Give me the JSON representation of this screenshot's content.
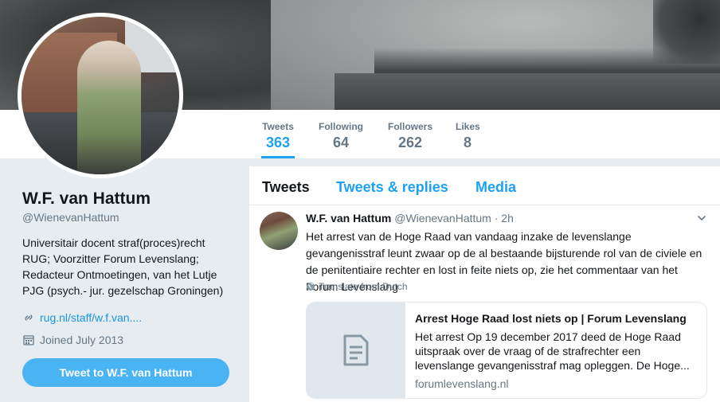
{
  "profile": {
    "name": "W.F. van Hattum",
    "handle": "@WienevanHattum",
    "bio": "Universitair docent straf(proces)recht RUG; Voorzitter Forum Levenslang; Redacteur Ontmoetingen, van het Lutje PJG (psych.- jur. gezelschap Groningen)",
    "website": "rug.nl/staff/w.f.van....",
    "joined": "Joined July 2013",
    "tweet_button": "Tweet to W.F. van Hattum"
  },
  "stats": [
    {
      "label": "Tweets",
      "value": "363"
    },
    {
      "label": "Following",
      "value": "64"
    },
    {
      "label": "Followers",
      "value": "262"
    },
    {
      "label": "Likes",
      "value": "8"
    }
  ],
  "tabs": [
    "Tweets",
    "Tweets & replies",
    "Media"
  ],
  "tweet": {
    "name": "W.F. van Hattum",
    "handle": "@WienevanHattum",
    "time": "· 2h",
    "text": "Het arrest van de Hoge Raad van vandaag inzake de levenslange gevangenisstraf leunt zwaar op de al bestaande bijsturende rol van de civiele en de penitentiaire rechter en lost in feite niets op, zie het commentaar van het Forum Levenslang",
    "translate": "Translate from Dutch",
    "card": {
      "title": "Arrest Hoge Raad lost niets op | Forum Levenslang",
      "description": "Het arrest Op 19 december 2017 deed de Hoge Raad uitspraak over de vraag of de strafrechter een levenslange gevangenisstraf mag opleggen. De Hoge...",
      "domain": "forumlevenslang.nl"
    }
  },
  "colors": {
    "accent": "#1da1f2",
    "button": "#4ab3f4",
    "muted": "#657786",
    "background": "#e6ecf0"
  },
  "icons": [
    "link-icon",
    "calendar-icon",
    "chevron-down-icon",
    "globe-icon",
    "document-icon"
  ]
}
